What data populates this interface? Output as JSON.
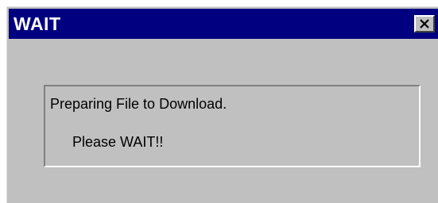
{
  "window": {
    "title": "WAIT",
    "close_icon": "close-icon"
  },
  "message": {
    "line1": "Preparing File to Download.",
    "line2": "Please WAIT!!"
  },
  "colors": {
    "titlebar": "#000080",
    "window_bg": "#c0c0c0",
    "title_text": "#ffffff"
  }
}
